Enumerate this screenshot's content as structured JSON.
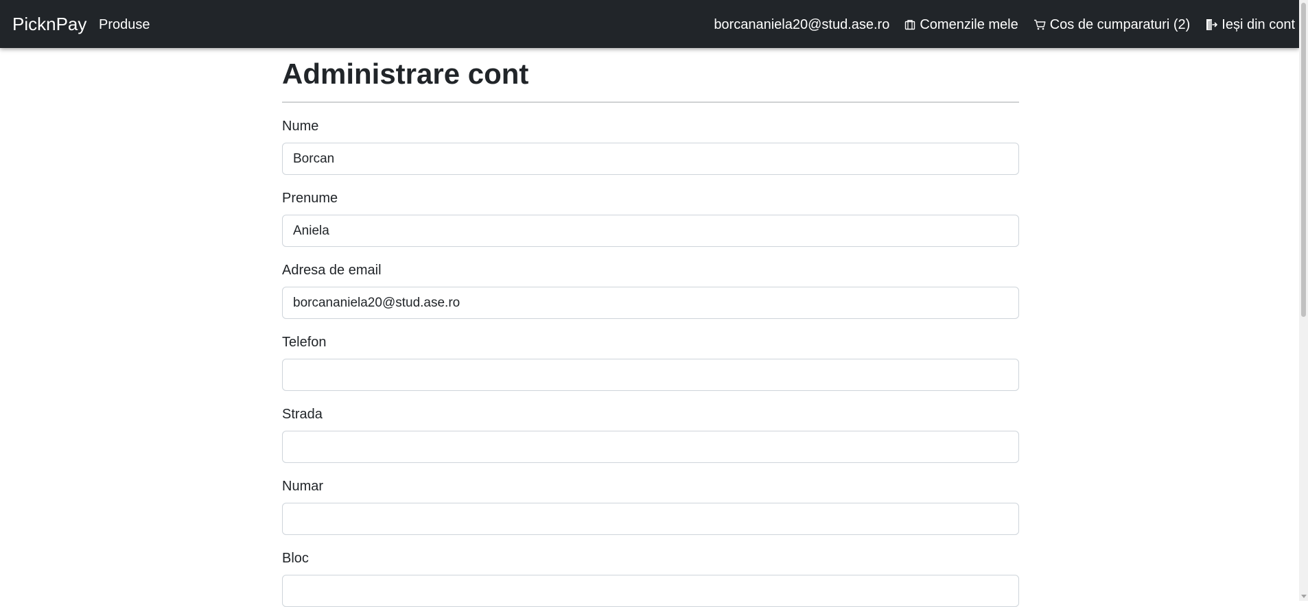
{
  "navbar": {
    "brand": "PicknPay",
    "left_link": "Produse",
    "user_email": "borcananiela20@stud.ase.ro",
    "orders_label": "Comenzile mele",
    "cart_label": "Cos de cumparaturi (2)",
    "logout_label": "Ieși din cont",
    "icons": [
      "orders-icon",
      "cart-icon",
      "logout-icon"
    ],
    "background": "#212529"
  },
  "page": {
    "title": "Administrare cont"
  },
  "form": {
    "fields": [
      {
        "label": "Nume",
        "value": "Borcan"
      },
      {
        "label": "Prenume",
        "value": "Aniela"
      },
      {
        "label": "Adresa de email",
        "value": "borcananiela20@stud.ase.ro"
      },
      {
        "label": "Telefon",
        "value": ""
      },
      {
        "label": "Strada",
        "value": ""
      },
      {
        "label": "Numar",
        "value": ""
      },
      {
        "label": "Bloc",
        "value": ""
      }
    ]
  }
}
